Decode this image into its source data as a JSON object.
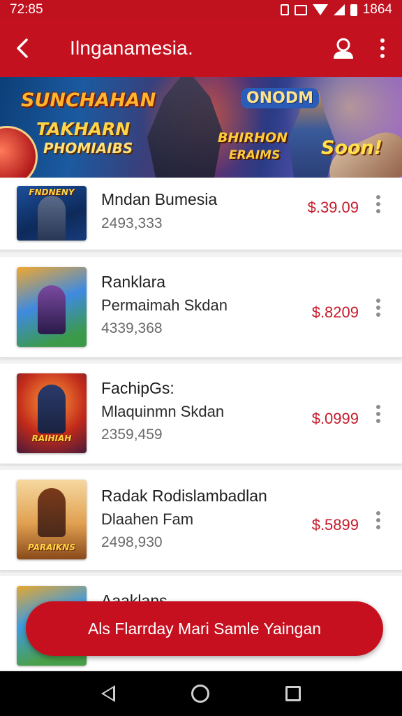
{
  "status_bar": {
    "time": "72:85",
    "clock": "1864"
  },
  "app_bar": {
    "title": "Ilnganamesia."
  },
  "banner": {
    "title": "SUNCHAHAN",
    "subtitle_1": "TAKHARN",
    "subtitle_2": "PHOMIAIBS",
    "badge": "ONODM",
    "subtitle_3": "BHIRHON",
    "subtitle_4": "ERAIMS",
    "tagline": "Soon!"
  },
  "items": [
    {
      "thumb_text": "FNDNENY",
      "title": "Mndan Bumesia",
      "subtitle": "",
      "count": "2493,333",
      "price": "$.39.09"
    },
    {
      "thumb_text": "",
      "title": "Ranklara",
      "subtitle": "Permaimah Skdan",
      "count": "4339,368",
      "price": "$.8209"
    },
    {
      "thumb_text": "RAIHIAH",
      "title": "FachipGs:",
      "subtitle": "Mlaquinmn Skdan",
      "count": "2359,459",
      "price": "$.0999"
    },
    {
      "thumb_text": "PARAIKNS",
      "title": "Radak Rodislambadlan",
      "subtitle": "Dlaahen Fam",
      "count": "2498,930",
      "price": "$.5899"
    },
    {
      "thumb_text": "",
      "title": "Aaaklans",
      "subtitle": "",
      "count": "",
      "price": ""
    }
  ],
  "fab": {
    "label": "Als Flarrday Mari Samle Yaingan"
  },
  "colors": {
    "primary": "#c4111f",
    "price": "#c51b2b",
    "background": "#f2f2f2"
  },
  "icons": {
    "back": "chevron-left-icon",
    "profile": "person-icon",
    "more": "more-vertical-icon",
    "nav_back": "triangle-back-icon",
    "nav_home": "circle-home-icon",
    "nav_recents": "square-recents-icon"
  }
}
